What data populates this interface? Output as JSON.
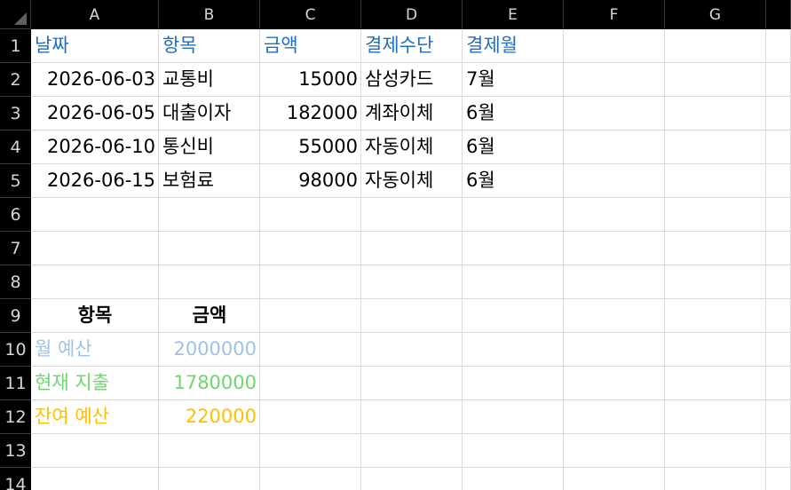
{
  "columns": [
    "A",
    "B",
    "C",
    "D",
    "E",
    "F",
    "G"
  ],
  "rows": [
    "1",
    "2",
    "3",
    "4",
    "5",
    "6",
    "7",
    "8",
    "9",
    "10",
    "11",
    "12",
    "13",
    "14"
  ],
  "colors": {
    "header_blue": "#1f6fc0",
    "text_black": "#000000",
    "budget_blue": "#9dc3e6",
    "spend_green": "#6fd66f",
    "remain_orange": "#ffc000"
  },
  "table": {
    "headers": [
      "날짜",
      "항목",
      "금액",
      "결제수단",
      "결제월"
    ],
    "rows": [
      [
        "2026-06-03",
        "교통비",
        "15000",
        "삼성카드",
        "7월"
      ],
      [
        "2026-06-05",
        "대출이자",
        "182000",
        "계좌이체",
        "6월"
      ],
      [
        "2026-06-10",
        "통신비",
        "55000",
        "자동이체",
        "6월"
      ],
      [
        "2026-06-15",
        "보험료",
        "98000",
        "자동이체",
        "6월"
      ]
    ]
  },
  "summary": {
    "header_item": "항목",
    "header_amount": "금액",
    "rows": [
      {
        "label": "월 예산",
        "value": "2000000",
        "color": "#9dc3e6"
      },
      {
        "label": "현재 지출",
        "value": "1780000",
        "color": "#6fd66f"
      },
      {
        "label": "잔여 예산",
        "value": "220000",
        "color": "#ffc000"
      }
    ]
  }
}
